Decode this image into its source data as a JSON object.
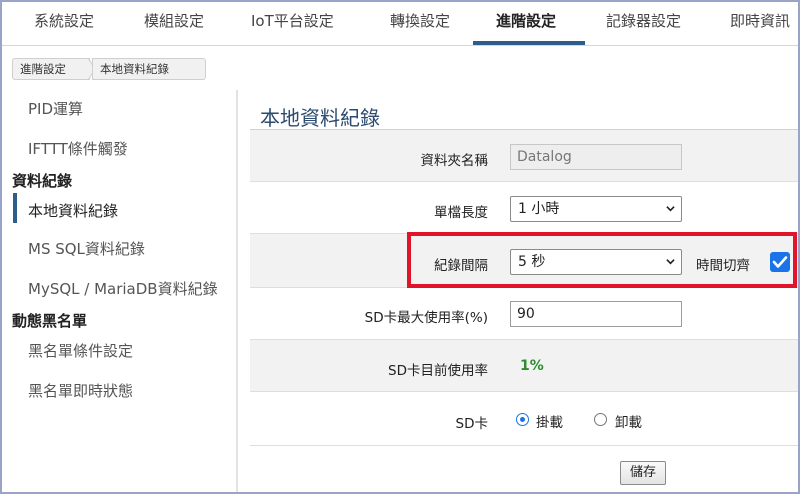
{
  "top_tabs": [
    {
      "label": "系統設定"
    },
    {
      "label": "模組設定"
    },
    {
      "label": "IoT平台設定"
    },
    {
      "label": "轉換設定"
    },
    {
      "label": "進階設定"
    },
    {
      "label": "記錄器設定"
    },
    {
      "label": "即時資訊"
    }
  ],
  "breadcrumb": [
    "進階設定",
    "本地資料紀錄"
  ],
  "sidebar": {
    "items": [
      {
        "label": "PID運算"
      },
      {
        "label": "IFTTT條件觸發"
      }
    ],
    "group_data_logging": "資料紀錄",
    "data_logging_items": [
      {
        "label": "本地資料紀錄"
      },
      {
        "label": "MS SQL資料紀錄"
      },
      {
        "label": "MySQL / MariaDB資料紀錄"
      }
    ],
    "group_blacklist": "動態黑名單",
    "blacklist_items": [
      {
        "label": "黑名單條件設定"
      },
      {
        "label": "黑名單即時狀態"
      }
    ]
  },
  "main": {
    "title": "本地資料紀錄",
    "folder_label": "資料夾名稱",
    "folder_value": "Datalog",
    "file_length_label": "單檔長度",
    "file_length_value": "1 小時",
    "interval_label": "紀錄間隔",
    "interval_value": "5 秒",
    "time_align_label": "時間切齊",
    "time_align_checked": true,
    "sd_max_label": "SD卡最大使用率(%)",
    "sd_max_value": "90",
    "sd_current_label": "SD卡目前使用率",
    "sd_current_value": "1%",
    "sd_label": "SD卡",
    "sd_mount_label": "掛載",
    "sd_unmount_label": "卸載",
    "sd_selected": "掛載",
    "save_label": "儲存"
  },
  "colors": {
    "accent": "#2f5d8a",
    "highlight": "#e0152b",
    "checkbox": "#1a73e8",
    "value_green": "#2e8b2e"
  },
  "icons": {
    "select_arrow": "chevron-down-icon",
    "checkbox": "checkmark-icon"
  }
}
